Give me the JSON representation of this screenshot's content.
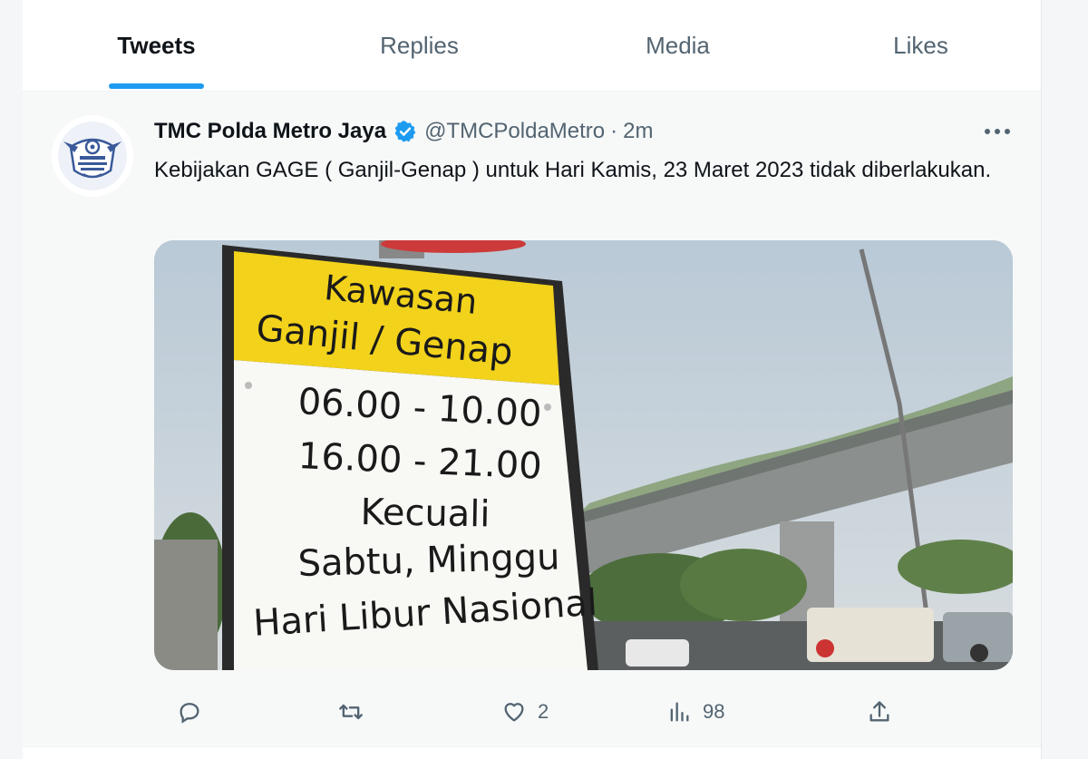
{
  "tabs": [
    {
      "label": "Tweets",
      "active": true
    },
    {
      "label": "Replies",
      "active": false
    },
    {
      "label": "Media",
      "active": false
    },
    {
      "label": "Likes",
      "active": false
    }
  ],
  "tweet": {
    "display_name": "TMC Polda Metro Jaya",
    "handle": "@TMCPoldaMetro",
    "separator": "·",
    "time": "2m",
    "more_icon": "more-horizontal-icon",
    "verified_icon": "verified-badge-icon",
    "text": "Kebijakan GAGE ( Ganjil-Genap ) untuk Hari Kamis, 23 Maret 2023 tidak diberlakukan.",
    "media": {
      "sign_header_line1": "Kawasan",
      "sign_header_line2": "Ganjil / Genap",
      "sign_line1": "06.00 - 10.00",
      "sign_line2": "16.00 - 21.00",
      "sign_line3": "Kecuali",
      "sign_line4": "Sabtu, Minggu",
      "sign_line5": "Hari Libur Nasional"
    },
    "actions": {
      "reply": {
        "icon": "reply-icon",
        "count": ""
      },
      "retweet": {
        "icon": "retweet-icon",
        "count": ""
      },
      "like": {
        "icon": "heart-icon",
        "count": "2"
      },
      "views": {
        "icon": "views-chart-icon",
        "count": "98"
      },
      "share": {
        "icon": "share-icon",
        "count": ""
      }
    }
  },
  "colors": {
    "accent": "#1d9bf0",
    "text_primary": "#0f1419",
    "text_secondary": "#536471",
    "sign_yellow": "#f2d21b"
  }
}
